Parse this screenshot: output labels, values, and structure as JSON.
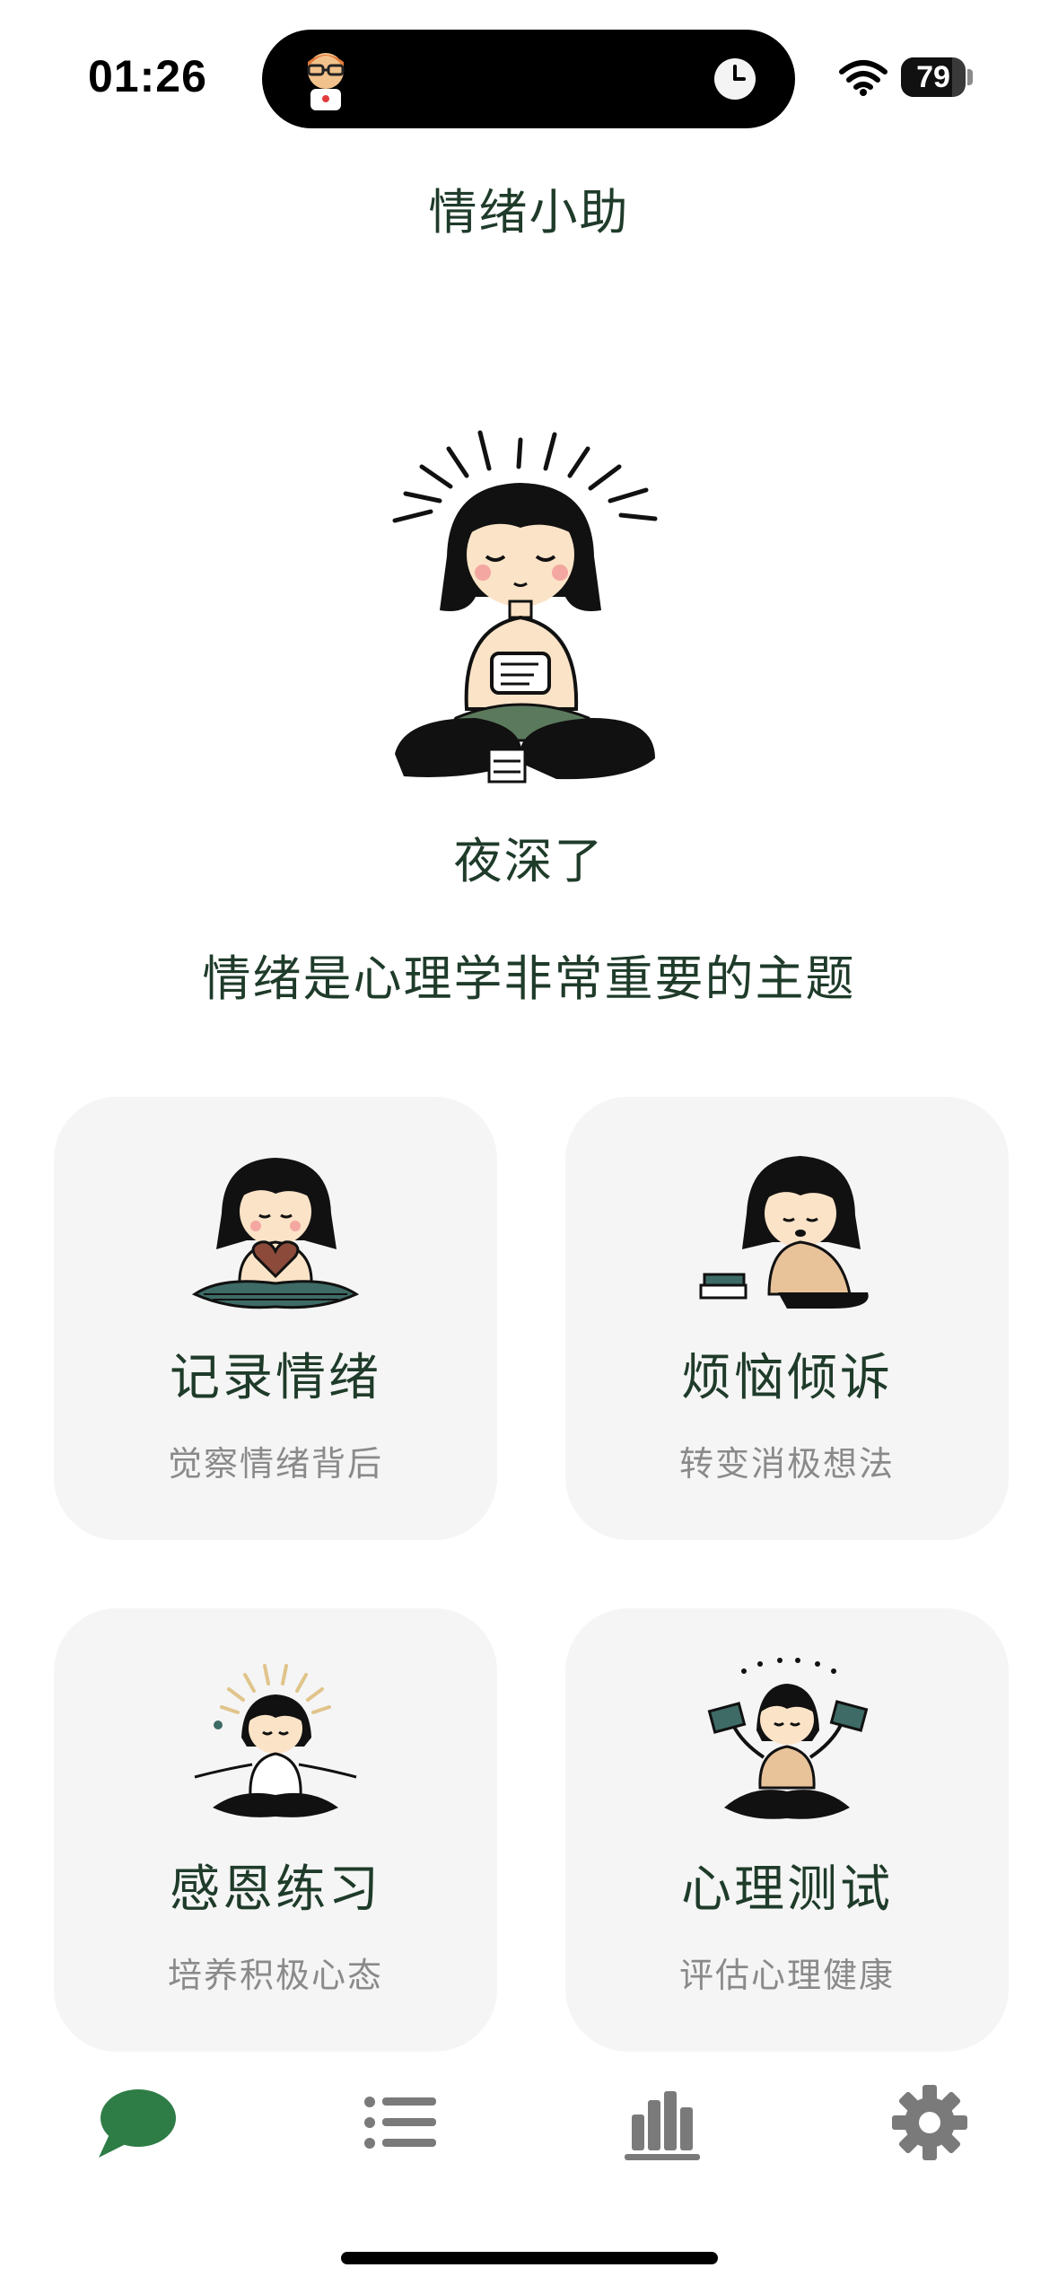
{
  "status_bar": {
    "time": "01:26",
    "battery_level": "79",
    "battery_fraction": 0.79,
    "icons": [
      "wifi-icon",
      "battery-icon",
      "clock-icon",
      "avatar-icon"
    ]
  },
  "header": {
    "title": "情绪小助"
  },
  "hero": {
    "greeting": "夜深了",
    "subtitle": "情绪是心理学非常重要的主题"
  },
  "cards": [
    {
      "title": "记录情绪",
      "desc": "觉察情绪背后",
      "icon": "girl-heart-illustration"
    },
    {
      "title": "烦恼倾诉",
      "desc": "转变消极想法",
      "icon": "girl-thinking-illustration"
    },
    {
      "title": "感恩练习",
      "desc": "培养积极心态",
      "icon": "girl-meditating-illustration"
    },
    {
      "title": "心理测试",
      "desc": "评估心理健康",
      "icon": "girl-cards-illustration"
    }
  ],
  "tab_bar": {
    "active_tab": "chat",
    "tabs": [
      "chat-bubble-icon",
      "list-icon",
      "bar-chart-icon",
      "gear-icon"
    ]
  },
  "colors": {
    "accent_green": "#2e7d46",
    "text_dark_green": "#1f3b2a",
    "card_bg": "#f5f5f5",
    "muted_text": "#8a8a8a",
    "tab_inactive": "#7a7a7a"
  }
}
